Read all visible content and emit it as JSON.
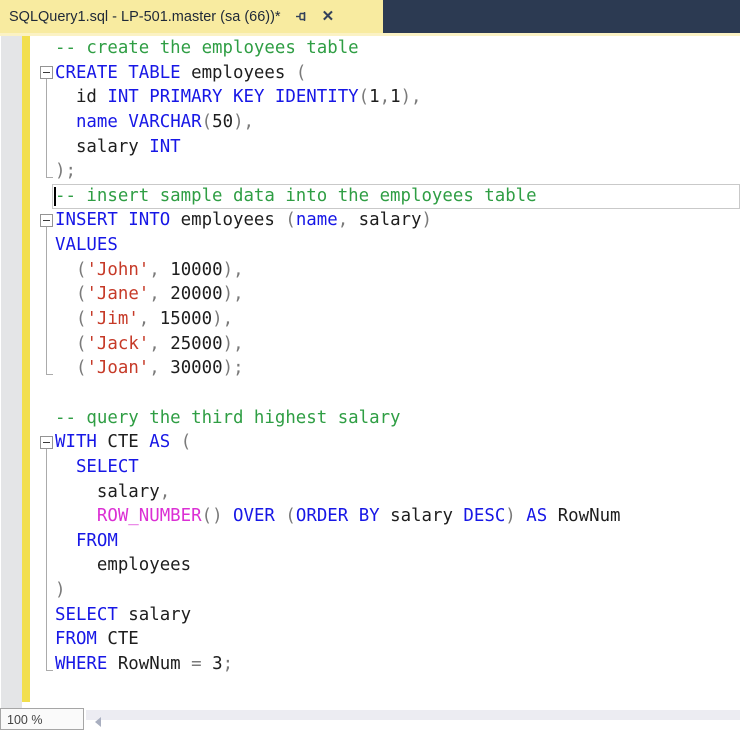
{
  "tab": {
    "title": "SQLQuery1.sql - LP-501.master (sa (66))*",
    "pin_icon": "pin-icon",
    "close_glyph": "✕"
  },
  "colors": {
    "tabbar_bg": "#2C3A52",
    "tab_bg": "#F8EBA0",
    "tab_underline": "#FBF2C4",
    "gutter": "#E4E5E7",
    "changebar": "#F2DF4E",
    "comment": "#2F9E44",
    "keyword": "#1717E6",
    "ident": "#1E1E1E",
    "string": "#C63A28",
    "func": "#DB2FD4",
    "oper": "#7A7A7A",
    "number": "#1E1E1E",
    "curline": "#C9C9C9"
  },
  "editor": {
    "language": "sql",
    "current_line": 7,
    "caret_line": 7,
    "fold_regions": [
      {
        "start": 2,
        "end": 6
      },
      {
        "start": 8,
        "end": 14
      },
      {
        "start": 17,
        "end": 26
      }
    ],
    "lines": [
      {
        "n": 1,
        "tokens": [
          [
            "c",
            "-- create the employees table"
          ]
        ]
      },
      {
        "n": 2,
        "tokens": [
          [
            "k",
            "CREATE TABLE"
          ],
          [
            "i",
            " employees "
          ],
          [
            "o",
            "("
          ]
        ]
      },
      {
        "n": 3,
        "tokens": [
          [
            "i",
            "  id "
          ],
          [
            "k",
            "INT PRIMARY KEY IDENTITY"
          ],
          [
            "o",
            "("
          ],
          [
            "n",
            "1"
          ],
          [
            "o",
            ","
          ],
          [
            "n",
            "1"
          ],
          [
            "o",
            "),"
          ]
        ]
      },
      {
        "n": 4,
        "tokens": [
          [
            "i",
            "  "
          ],
          [
            "k",
            "name"
          ],
          [
            "i",
            " "
          ],
          [
            "k",
            "VARCHAR"
          ],
          [
            "o",
            "("
          ],
          [
            "n",
            "50"
          ],
          [
            "o",
            "),"
          ]
        ]
      },
      {
        "n": 5,
        "tokens": [
          [
            "i",
            "  salary "
          ],
          [
            "k",
            "INT"
          ]
        ]
      },
      {
        "n": 6,
        "tokens": [
          [
            "o",
            ");"
          ]
        ]
      },
      {
        "n": 7,
        "tokens": [
          [
            "c",
            "-- insert sample data into the employees table"
          ]
        ]
      },
      {
        "n": 8,
        "tokens": [
          [
            "k",
            "INSERT INTO"
          ],
          [
            "i",
            " employees "
          ],
          [
            "o",
            "("
          ],
          [
            "k",
            "name"
          ],
          [
            "o",
            ","
          ],
          [
            "i",
            " salary"
          ],
          [
            "o",
            ")"
          ]
        ]
      },
      {
        "n": 9,
        "tokens": [
          [
            "k",
            "VALUES"
          ]
        ]
      },
      {
        "n": 10,
        "tokens": [
          [
            "i",
            "  "
          ],
          [
            "o",
            "("
          ],
          [
            "s",
            "'John'"
          ],
          [
            "o",
            ","
          ],
          [
            "i",
            " "
          ],
          [
            "n",
            "10000"
          ],
          [
            "o",
            "),"
          ]
        ]
      },
      {
        "n": 11,
        "tokens": [
          [
            "i",
            "  "
          ],
          [
            "o",
            "("
          ],
          [
            "s",
            "'Jane'"
          ],
          [
            "o",
            ","
          ],
          [
            "i",
            " "
          ],
          [
            "n",
            "20000"
          ],
          [
            "o",
            "),"
          ]
        ]
      },
      {
        "n": 12,
        "tokens": [
          [
            "i",
            "  "
          ],
          [
            "o",
            "("
          ],
          [
            "s",
            "'Jim'"
          ],
          [
            "o",
            ","
          ],
          [
            "i",
            " "
          ],
          [
            "n",
            "15000"
          ],
          [
            "o",
            "),"
          ]
        ]
      },
      {
        "n": 13,
        "tokens": [
          [
            "i",
            "  "
          ],
          [
            "o",
            "("
          ],
          [
            "s",
            "'Jack'"
          ],
          [
            "o",
            ","
          ],
          [
            "i",
            " "
          ],
          [
            "n",
            "25000"
          ],
          [
            "o",
            "),"
          ]
        ]
      },
      {
        "n": 14,
        "tokens": [
          [
            "i",
            "  "
          ],
          [
            "o",
            "("
          ],
          [
            "s",
            "'Joan'"
          ],
          [
            "o",
            ","
          ],
          [
            "i",
            " "
          ],
          [
            "n",
            "30000"
          ],
          [
            "o",
            ");"
          ]
        ]
      },
      {
        "n": 15,
        "tokens": []
      },
      {
        "n": 16,
        "tokens": [
          [
            "c",
            "-- query the third highest salary"
          ]
        ]
      },
      {
        "n": 17,
        "tokens": [
          [
            "k",
            "WITH"
          ],
          [
            "i",
            " CTE "
          ],
          [
            "k",
            "AS"
          ],
          [
            "i",
            " "
          ],
          [
            "o",
            "("
          ]
        ]
      },
      {
        "n": 18,
        "tokens": [
          [
            "i",
            "  "
          ],
          [
            "k",
            "SELECT"
          ]
        ]
      },
      {
        "n": 19,
        "tokens": [
          [
            "i",
            "    salary"
          ],
          [
            "o",
            ","
          ]
        ]
      },
      {
        "n": 20,
        "tokens": [
          [
            "i",
            "    "
          ],
          [
            "f",
            "ROW_NUMBER"
          ],
          [
            "o",
            "() "
          ],
          [
            "k",
            "OVER"
          ],
          [
            "i",
            " "
          ],
          [
            "o",
            "("
          ],
          [
            "k",
            "ORDER BY"
          ],
          [
            "i",
            " salary "
          ],
          [
            "k",
            "DESC"
          ],
          [
            "o",
            ")"
          ],
          [
            "i",
            " "
          ],
          [
            "k",
            "AS"
          ],
          [
            "i",
            " RowNum"
          ]
        ]
      },
      {
        "n": 21,
        "tokens": [
          [
            "i",
            "  "
          ],
          [
            "k",
            "FROM"
          ]
        ]
      },
      {
        "n": 22,
        "tokens": [
          [
            "i",
            "    employees"
          ]
        ]
      },
      {
        "n": 23,
        "tokens": [
          [
            "o",
            ")"
          ]
        ]
      },
      {
        "n": 24,
        "tokens": [
          [
            "k",
            "SELECT"
          ],
          [
            "i",
            " salary"
          ]
        ]
      },
      {
        "n": 25,
        "tokens": [
          [
            "k",
            "FROM"
          ],
          [
            "i",
            " CTE"
          ]
        ]
      },
      {
        "n": 26,
        "tokens": [
          [
            "k",
            "WHERE"
          ],
          [
            "i",
            " RowNum "
          ],
          [
            "o",
            "="
          ],
          [
            "i",
            " "
          ],
          [
            "n",
            "3"
          ],
          [
            "o",
            ";"
          ]
        ]
      }
    ]
  },
  "statusbar": {
    "zoom_level": "100 %",
    "scroll_left_icon": "scroll-left-arrow"
  }
}
